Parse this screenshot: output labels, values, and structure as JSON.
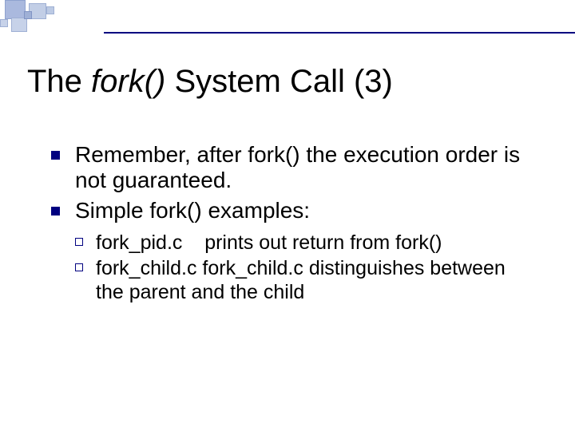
{
  "title": {
    "pre": "The ",
    "italic": "fork()",
    "post": " System Call (3)"
  },
  "bullets": {
    "b1": "Remember, after fork() the execution order is not guaranteed.",
    "b2": "Simple fork() examples:"
  },
  "sub": {
    "s1_file": "fork_pid.c",
    "s1_gap": "    ",
    "s1_desc": "prints out return from fork()",
    "s2_file": "fork_child.c",
    "s2_gap": " ",
    "s2_mid": "fork_child.c",
    "s2_gap2": " ",
    "s2_desc": "distinguishes between the parent and the child"
  }
}
